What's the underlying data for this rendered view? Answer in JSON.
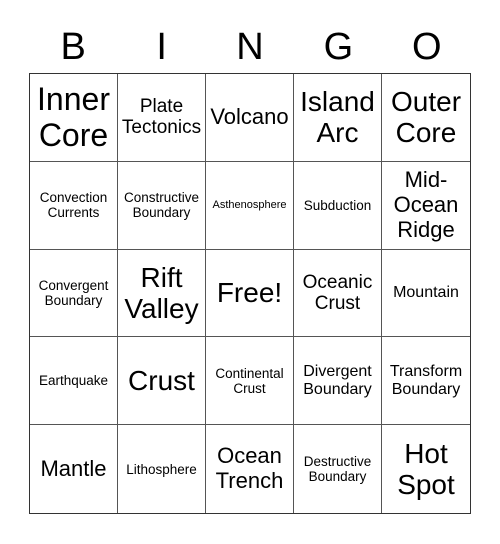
{
  "header": [
    "B",
    "I",
    "N",
    "G",
    "O"
  ],
  "cells": [
    [
      "Inner Core",
      "Plate Tectonics",
      "Volcano",
      "Island Arc",
      "Outer Core"
    ],
    [
      "Convection Currents",
      "Constructive Boundary",
      "Asthenosphere",
      "Subduction",
      "Mid-Ocean Ridge"
    ],
    [
      "Convergent Boundary",
      "Rift Valley",
      "Free!",
      "Oceanic Crust",
      "Mountain"
    ],
    [
      "Earthquake",
      "Crust",
      "Continental Crust",
      "Divergent Boundary",
      "Transform Boundary"
    ],
    [
      "Mantle",
      "Lithosphere",
      "Ocean Trench",
      "Destructive Boundary",
      "Hot Spot"
    ]
  ]
}
